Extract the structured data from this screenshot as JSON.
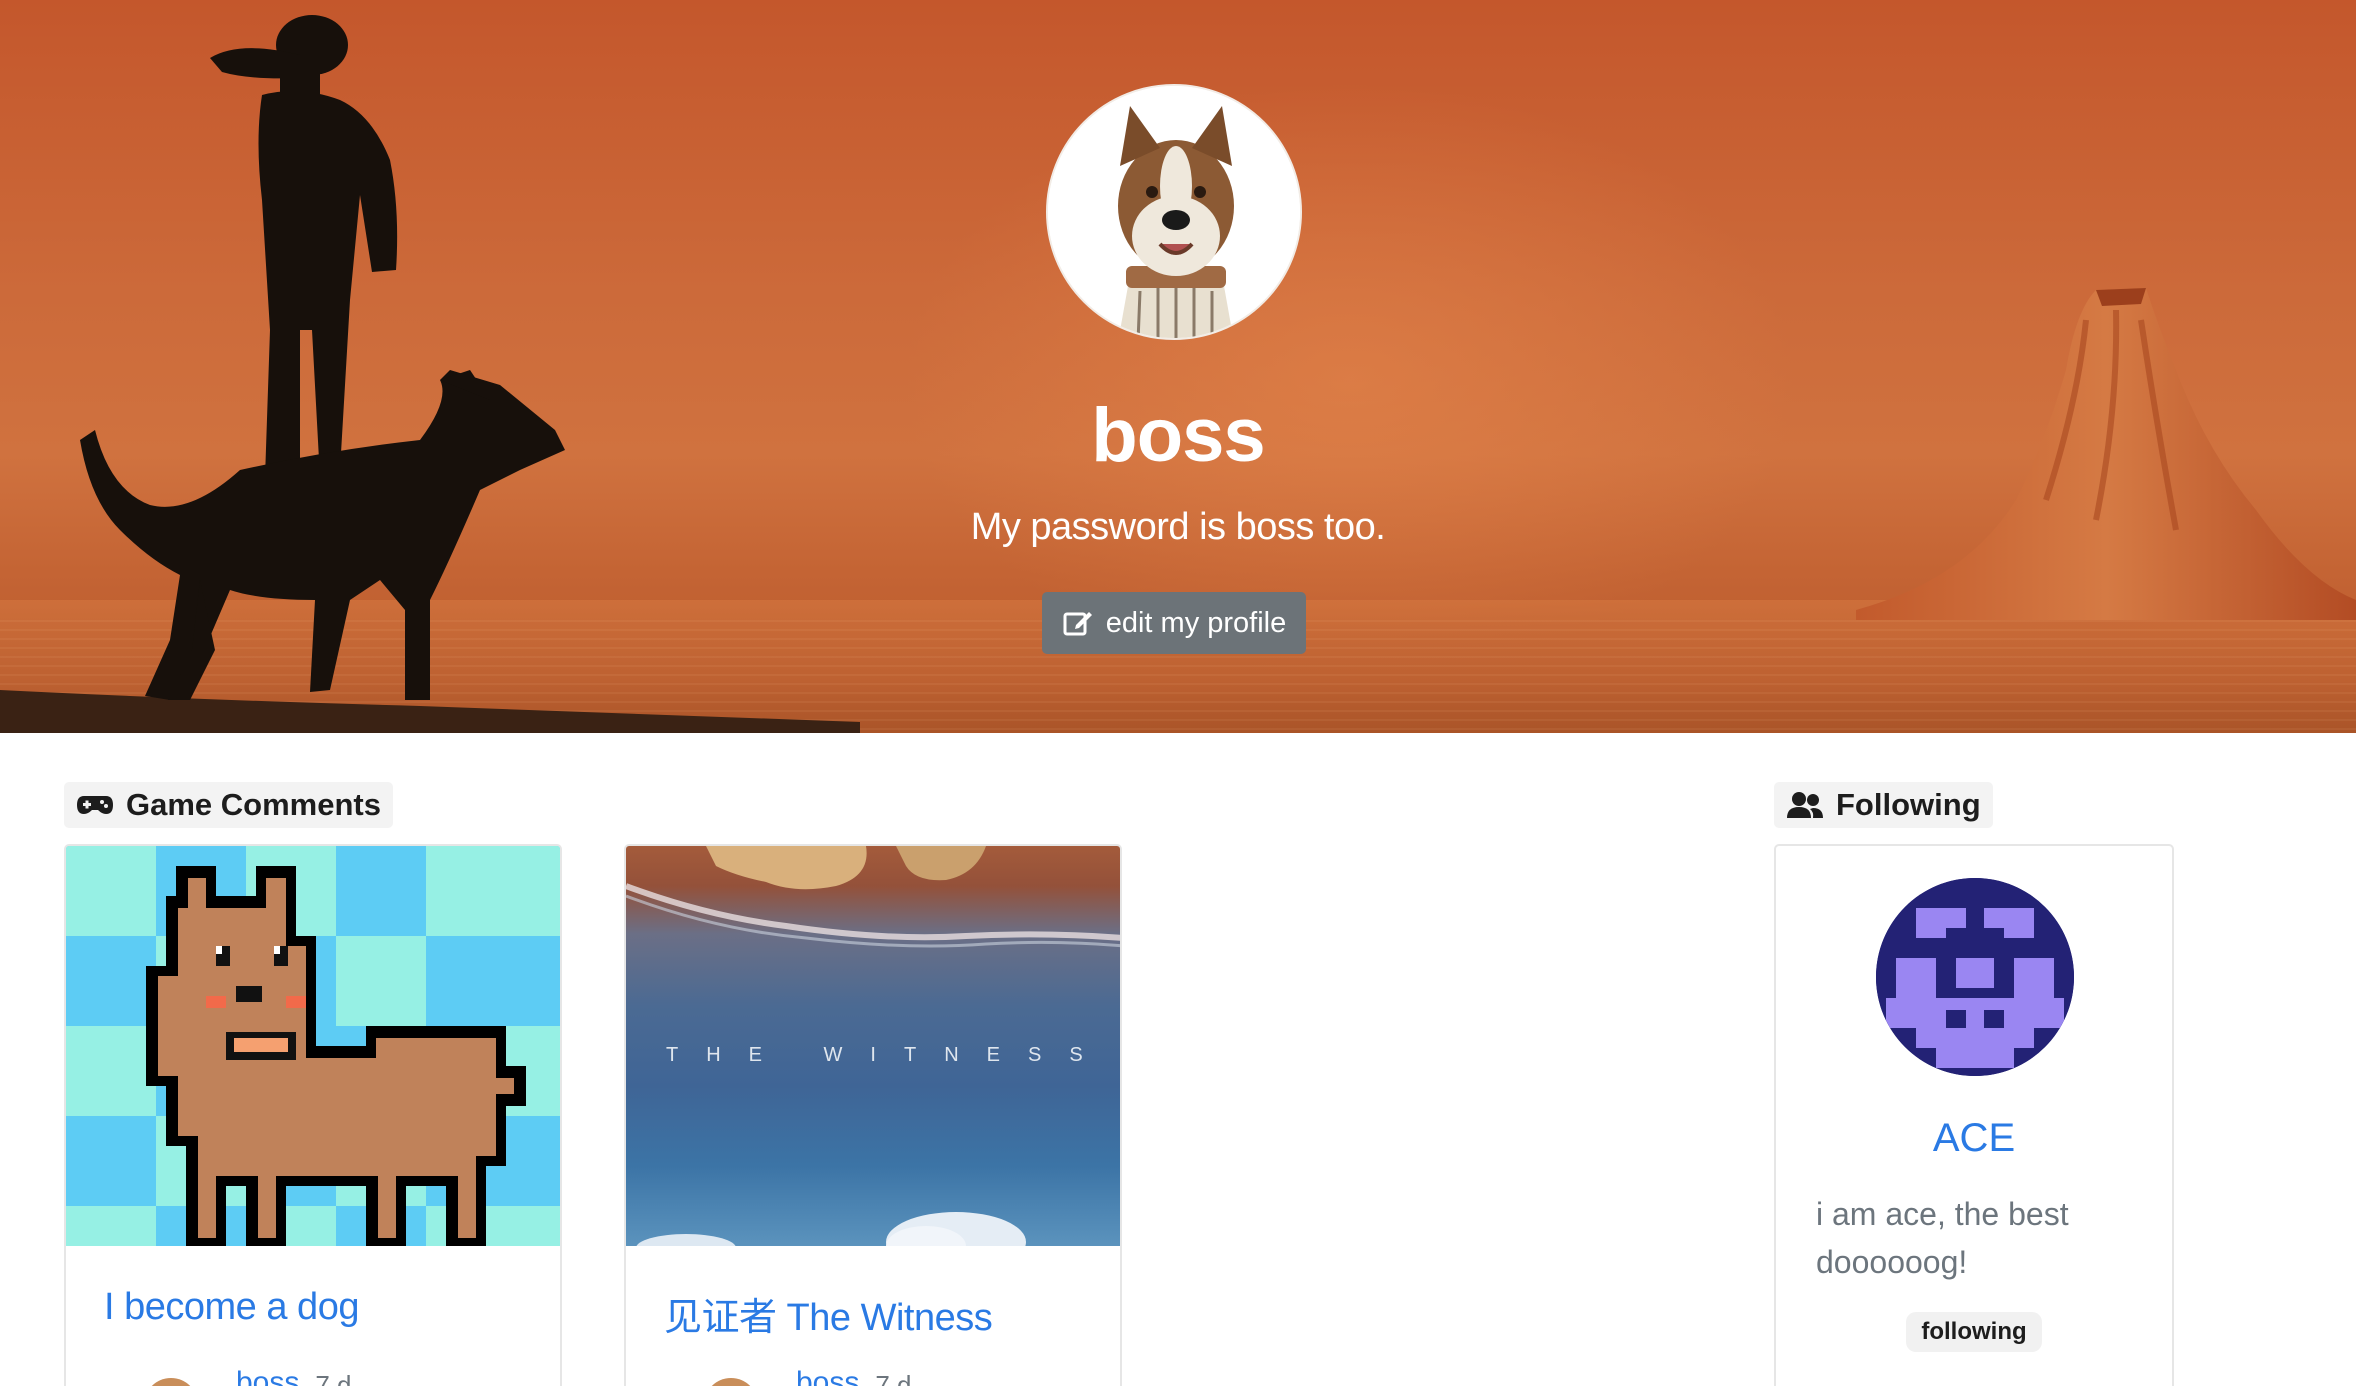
{
  "profile": {
    "username": "boss",
    "bio": "My password is boss too.",
    "edit_label": "edit my profile"
  },
  "game_comments": {
    "heading": "Game Comments",
    "items": [
      {
        "title": "I become a dog",
        "user": "boss",
        "time": "7 d"
      },
      {
        "title": "见证者 The Witness",
        "user": "boss",
        "time": "7 d",
        "cover_text": "THE WITNESS"
      }
    ]
  },
  "following": {
    "heading": "Following",
    "users": [
      {
        "name": "ACE",
        "bio": "i am ace, the best doooooog!",
        "status": "following"
      }
    ]
  },
  "colors": {
    "accent": "#2a7ae4",
    "hero": "#c4572c",
    "button": "#6c7378",
    "muted": "#6c757d"
  },
  "icons": [
    "edit-icon",
    "gamepad-icon",
    "users-icon"
  ]
}
